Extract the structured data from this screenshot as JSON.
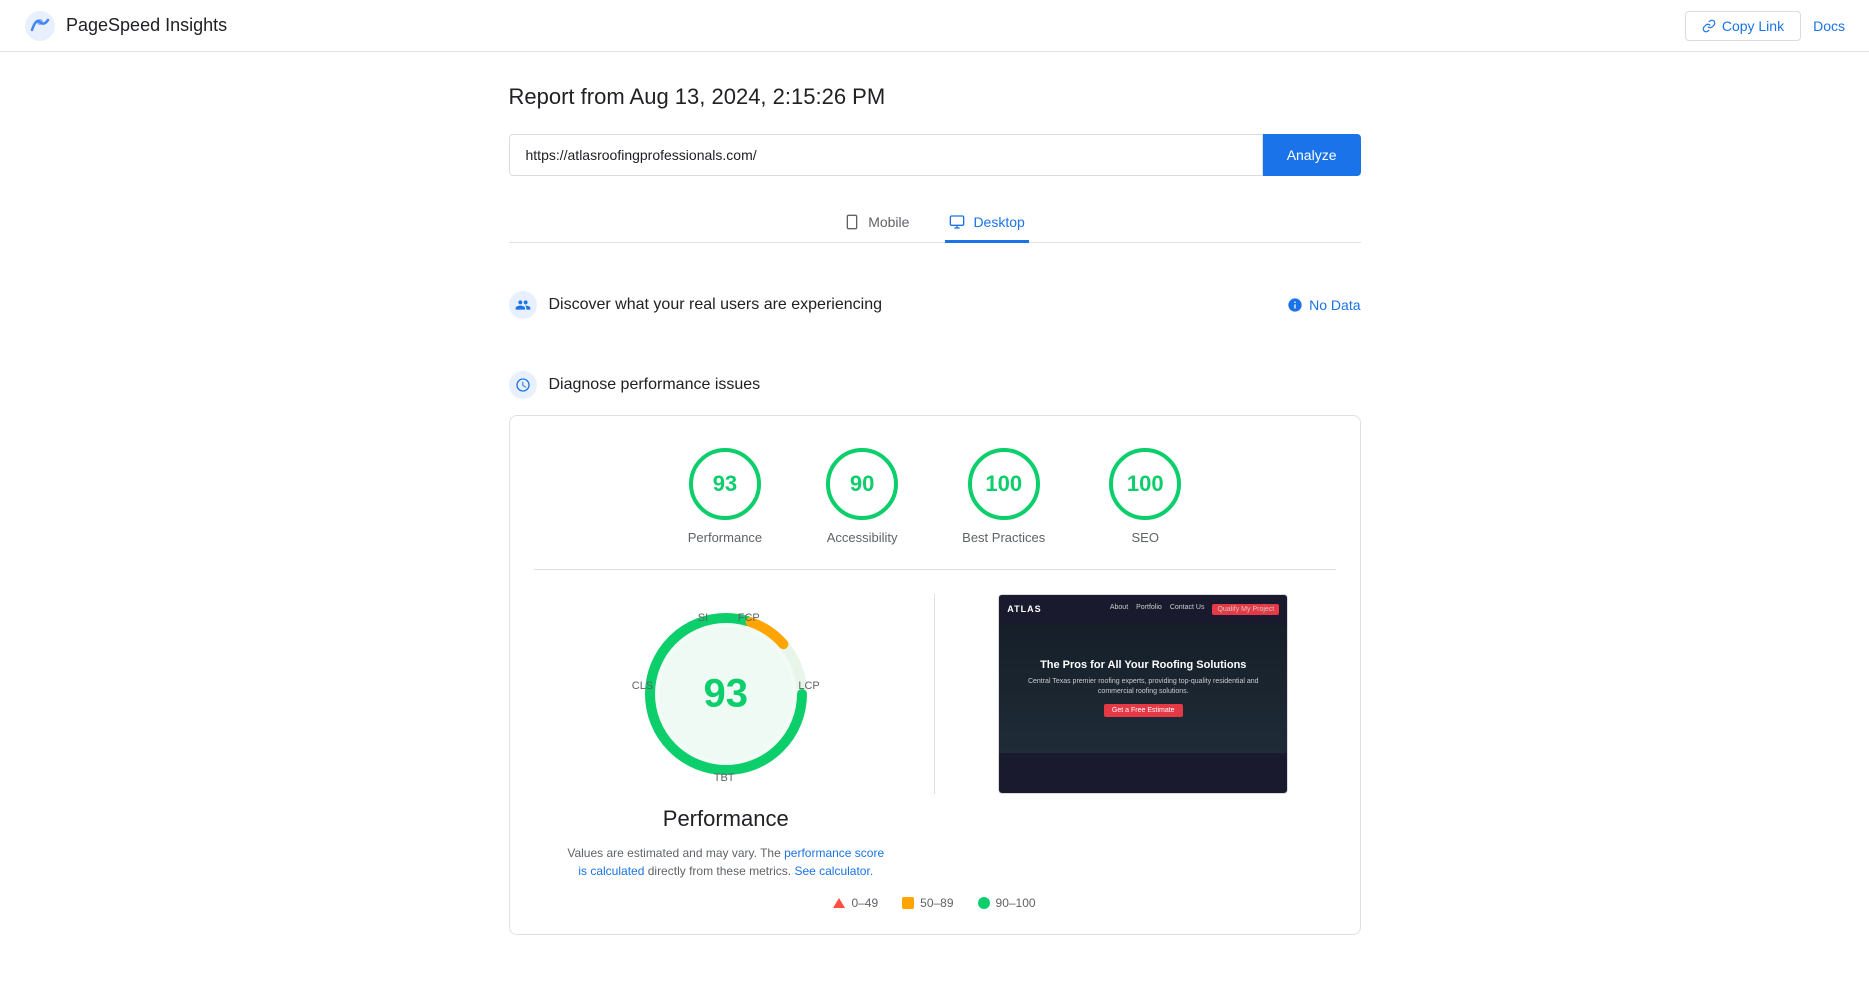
{
  "header": {
    "title": "PageSpeed Insights",
    "copy_link_label": "Copy Link",
    "docs_label": "Docs"
  },
  "report": {
    "title": "Report from Aug 13, 2024, 2:15:26 PM",
    "url": "https://atlasroofingprofessionals.com/",
    "analyze_label": "Analyze"
  },
  "tabs": [
    {
      "id": "mobile",
      "label": "Mobile",
      "active": false
    },
    {
      "id": "desktop",
      "label": "Desktop",
      "active": true
    }
  ],
  "real_users": {
    "title": "Discover what your real users are experiencing",
    "no_data_label": "No Data"
  },
  "diagnose": {
    "title": "Diagnose performance issues"
  },
  "scores": [
    {
      "label": "Performance",
      "value": "93",
      "color": "#0cce6b"
    },
    {
      "label": "Accessibility",
      "value": "90",
      "color": "#0cce6b"
    },
    {
      "label": "Best Practices",
      "value": "100",
      "color": "#0cce6b"
    },
    {
      "label": "SEO",
      "value": "100",
      "color": "#0cce6b"
    }
  ],
  "gauge": {
    "score": "93",
    "title": "Performance",
    "labels": {
      "si": "SI",
      "fcp": "FCP",
      "lcp": "LCP",
      "tbt": "TBT",
      "cls": "CLS"
    }
  },
  "perf_note": {
    "text1": "Values are estimated and may vary. The ",
    "link1": "performance score is calculated",
    "text2": " directly from these metrics. ",
    "link2": "See calculator."
  },
  "legend": [
    {
      "type": "triangle",
      "color": "#ff4e42",
      "label": "0–49"
    },
    {
      "type": "square",
      "color": "#ffa400",
      "label": "50–89"
    },
    {
      "type": "circle",
      "color": "#0cce6b",
      "label": "90–100"
    }
  ],
  "screenshot": {
    "hero_title": "The Pros for All Your Roofing Solutions",
    "hero_text": "Central Texas premier roofing experts, providing top-quality residential and commercial roofing solutions.",
    "cta_label": "Get a Free Estimate",
    "brand": "ATLAS",
    "nav_items": [
      "About",
      "Portfolio",
      "Contact Us"
    ],
    "nav_btn": "Qualify My Project"
  }
}
